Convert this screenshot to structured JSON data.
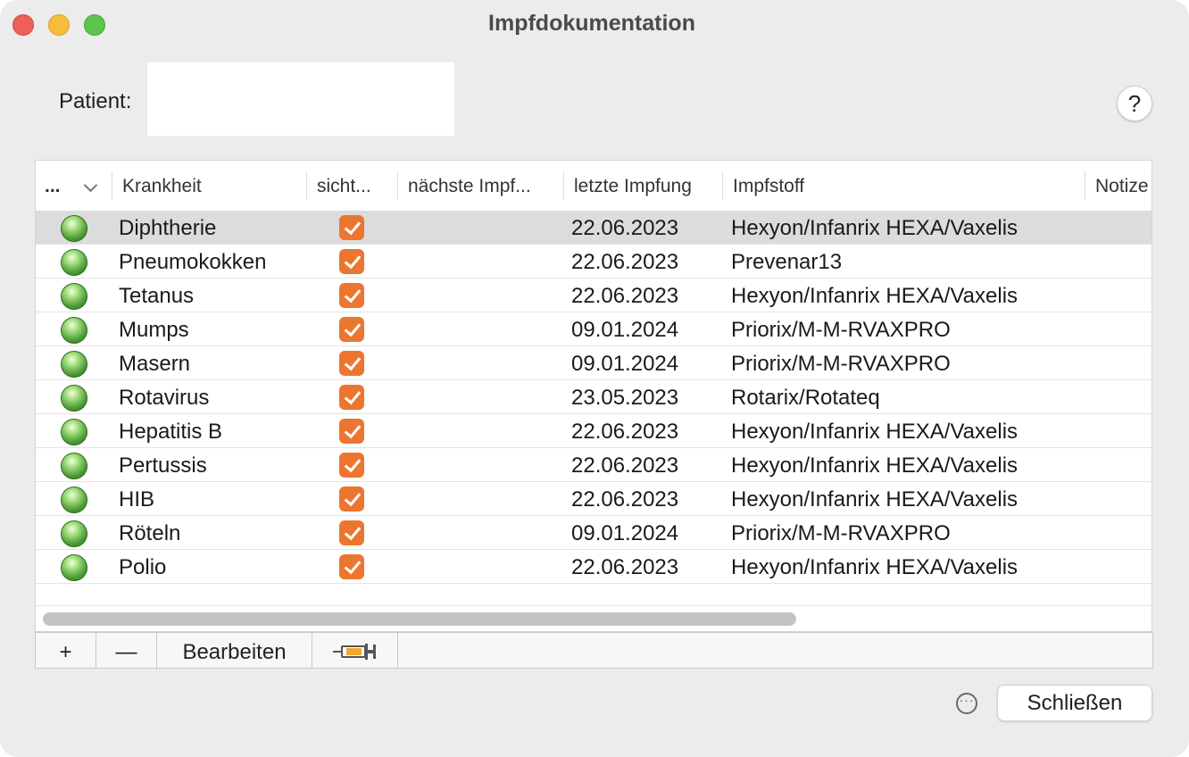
{
  "window": {
    "title": "Impfdokumentation"
  },
  "patient": {
    "label": "Patient:",
    "value": ""
  },
  "help": {
    "label": "?"
  },
  "table": {
    "columns": [
      {
        "label": "..."
      },
      {
        "label": "Krankheit"
      },
      {
        "label": "sicht..."
      },
      {
        "label": "nächste Impf..."
      },
      {
        "label": "letzte Impfung"
      },
      {
        "label": "Impfstoff"
      },
      {
        "label": "Notize"
      }
    ],
    "rows": [
      {
        "disease": "Diphtherie",
        "visible": true,
        "next": "",
        "last": "22.06.2023",
        "vaccine": "Hexyon/Infanrix HEXA/Vaxelis",
        "note": "",
        "status_color": "#5fae45"
      },
      {
        "disease": "Pneumokokken",
        "visible": true,
        "next": "",
        "last": "22.06.2023",
        "vaccine": "Prevenar13",
        "note": "",
        "status_color": "#5fae45"
      },
      {
        "disease": "Tetanus",
        "visible": true,
        "next": "",
        "last": "22.06.2023",
        "vaccine": "Hexyon/Infanrix HEXA/Vaxelis",
        "note": "",
        "status_color": "#5fae45"
      },
      {
        "disease": "Mumps",
        "visible": true,
        "next": "",
        "last": "09.01.2024",
        "vaccine": "Priorix/M-M-RVAXPRO",
        "note": "",
        "status_color": "#5fae45"
      },
      {
        "disease": "Masern",
        "visible": true,
        "next": "",
        "last": "09.01.2024",
        "vaccine": "Priorix/M-M-RVAXPRO",
        "note": "",
        "status_color": "#5fae45"
      },
      {
        "disease": "Rotavirus",
        "visible": true,
        "next": "",
        "last": "23.05.2023",
        "vaccine": "Rotarix/Rotateq",
        "note": "",
        "status_color": "#5fae45"
      },
      {
        "disease": "Hepatitis B",
        "visible": true,
        "next": "",
        "last": "22.06.2023",
        "vaccine": "Hexyon/Infanrix HEXA/Vaxelis",
        "note": "",
        "status_color": "#5fae45"
      },
      {
        "disease": "Pertussis",
        "visible": true,
        "next": "",
        "last": "22.06.2023",
        "vaccine": "Hexyon/Infanrix HEXA/Vaxelis",
        "note": "",
        "status_color": "#5fae45"
      },
      {
        "disease": "HIB",
        "visible": true,
        "next": "",
        "last": "22.06.2023",
        "vaccine": "Hexyon/Infanrix HEXA/Vaxelis",
        "note": "",
        "status_color": "#5fae45"
      },
      {
        "disease": "Röteln",
        "visible": true,
        "next": "",
        "last": "09.01.2024",
        "vaccine": "Priorix/M-M-RVAXPRO",
        "note": "",
        "status_color": "#5fae45"
      },
      {
        "disease": "Polio",
        "visible": true,
        "next": "",
        "last": "22.06.2023",
        "vaccine": "Hexyon/Infanrix HEXA/Vaxelis",
        "note": "",
        "status_color": "#5fae45"
      }
    ]
  },
  "toolbar": {
    "add_label": "+",
    "remove_label": "—",
    "edit_label": "Bearbeiten",
    "syringe_icon": "syringe-icon"
  },
  "footer": {
    "more_icon": "ellipsis-circle-icon",
    "close_label": "Schließen"
  },
  "colors": {
    "checkbox": "#ec7630",
    "status_ok": "#5fae45",
    "selected_row": "#dcdcdc"
  }
}
